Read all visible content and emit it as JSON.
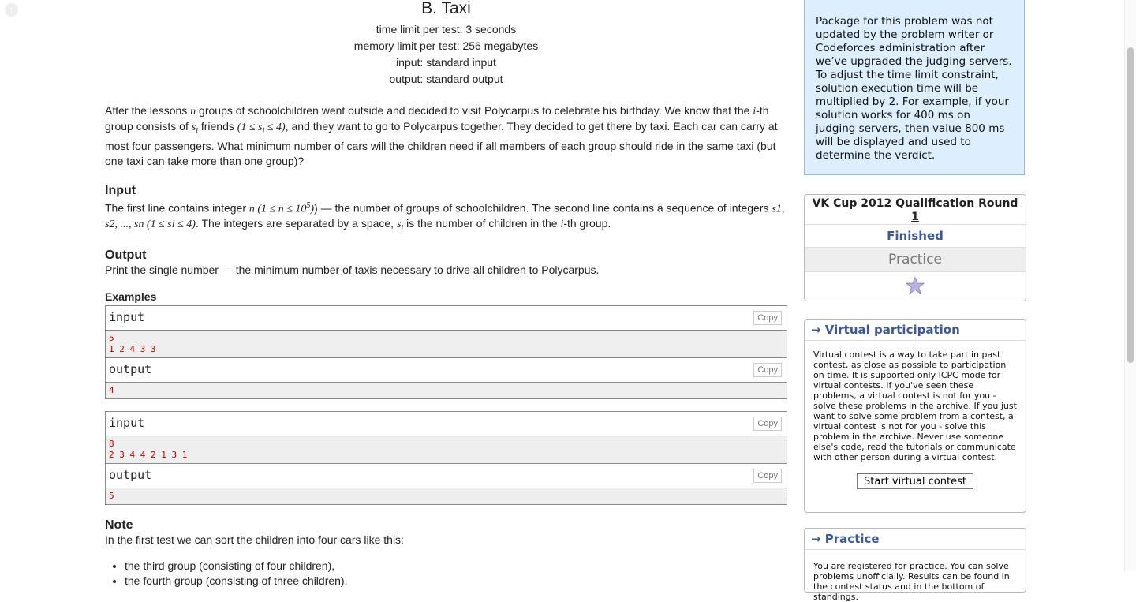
{
  "problem": {
    "title": "B. Taxi",
    "limits": [
      "time limit per test: 3 seconds",
      "memory limit per test: 256 megabytes",
      "input: standard input",
      "output: standard output"
    ],
    "statement": [
      {
        "t": "After the lessons "
      },
      {
        "m": "n"
      },
      {
        "t": " groups of schoolchildren went outside and decided to visit Polycarpus to celebrate his birthday. We know that the "
      },
      {
        "m": "i"
      },
      {
        "t": "-th group consists of "
      },
      {
        "m": "s"
      },
      {
        "sub": "i"
      },
      {
        "t": " friends "
      },
      {
        "m": "(1 ≤ s"
      },
      {
        "sub": "i"
      },
      {
        "m": " ≤ 4)"
      },
      {
        "t": ", and they want to go to Polycarpus together. They decided to get there by taxi. Each car can carry at most four passengers. What minimum number of cars will the children need if all members of each group should ride in the same taxi (but one taxi can take more than one group)?"
      }
    ],
    "input_title": "Input",
    "input_text_1": "The first line contains integer ",
    "input_math_1": "n (1 ≤ n ≤ 10",
    "input_sup": "5",
    "input_text_2": ") — the number of groups of schoolchildren. The second line contains a sequence of integers ",
    "input_math_2": "s",
    "input_text_3": "1, s",
    "input_text_4": "2, ..., s",
    "input_text_5": "n (1 ≤ s",
    "input_text_6": "i ≤ 4)",
    "input_text_7": ". The integers are separated by a space, ",
    "input_text_8": "s",
    "input_text_9": "i",
    "input_text_10": " is the number of children in the ",
    "input_text_11": "i",
    "input_text_12": "-th group.",
    "output_title": "Output",
    "output_text": "Print the single number — the minimum number of taxis necessary to drive all children to Polycarpus.",
    "examples_title": "Examples",
    "examples": [
      {
        "input_label": "input",
        "input_lines": [
          "5",
          "1 2 4 3 3"
        ],
        "output_label": "output",
        "output_lines": [
          "4"
        ],
        "copy": "Copy"
      },
      {
        "input_label": "input",
        "input_lines": [
          "8",
          "2 3 4 4 2 1 3 1"
        ],
        "output_label": "output",
        "output_lines": [
          "5"
        ],
        "copy": "Copy"
      }
    ],
    "note_title": "Note",
    "note_text": "In the first test we can sort the children into four cars like this:",
    "note_items": [
      "the third group (consisting of four children),",
      "the fourth group (consisting of three children),"
    ]
  },
  "sidebar": {
    "notice": "Package for this problem was not updated by the problem writer or Codeforces administration after we’ve upgraded the judging servers. To adjust the time limit constraint, solution execution time will be multiplied by 2. For example, if your solution works for 400 ms on judging servers, then value 800 ms will be displayed and used to determine the verdict.",
    "contest_name": "VK Cup 2012 Qualification Round 1",
    "contest_status": "Finished",
    "contest_phase": "Practice",
    "virtual_title": "→ Virtual participation",
    "virtual_text": "Virtual contest is a way to take part in past contest, as close as possible to participation on time. It is supported only ICPC mode for virtual contests. If you've seen these problems, a virtual contest is not for you - solve these problems in the archive. If you just want to solve some problem from a contest, a virtual contest is not for you - solve this problem in the archive. Never use someone else's code, read the tutorials or communicate with other person during a virtual contest.",
    "start_button": "Start virtual contest",
    "practice_title": "→ Practice",
    "practice_text": "You are registered for practice. You can solve problems unofficially. Results can be found in the contest status and in the bottom of standings."
  },
  "colors": {
    "link": "#3b5998",
    "sample_text": "#b00000",
    "notice_bg": "#ddeeff"
  }
}
